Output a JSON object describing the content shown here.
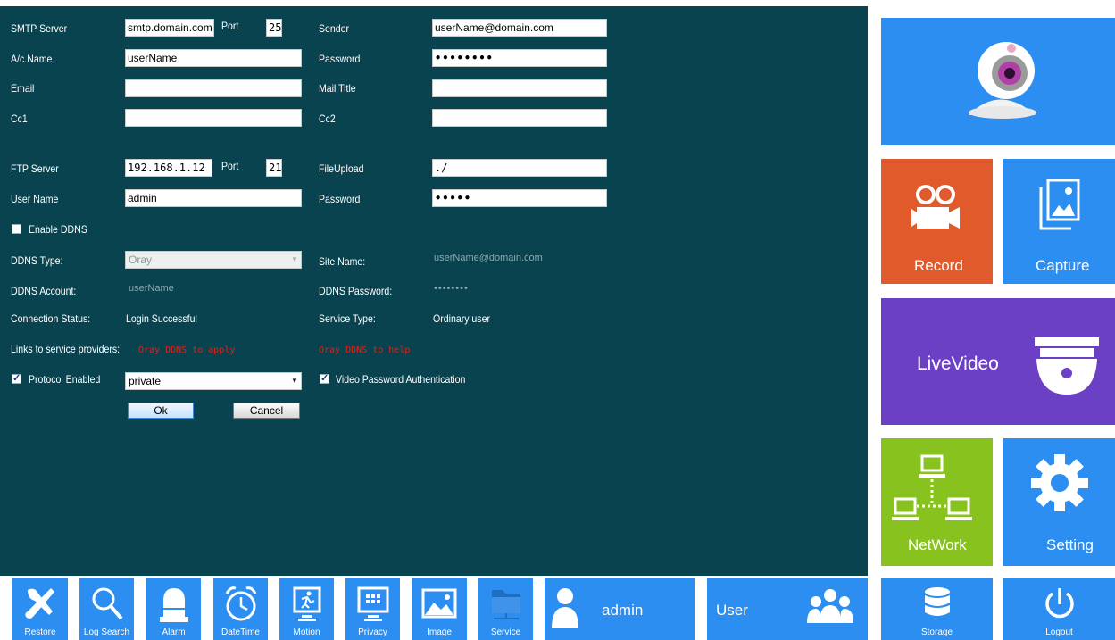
{
  "smtp": {
    "server_label": "SMTP Server",
    "server_value": "smtp.domain.com",
    "port_label": "Port",
    "port_value": "25",
    "sender_label": "Sender",
    "sender_value": "userName@domain.com",
    "account_label": "A/c.Name",
    "account_value": "userName",
    "password_label": "Password",
    "password_value": "••••••••",
    "email_label": "Email",
    "email_value": "",
    "mail_title_label": "Mail Title",
    "mail_title_value": "",
    "cc1_label": "Cc1",
    "cc1_value": "",
    "cc2_label": "Cc2",
    "cc2_value": ""
  },
  "ftp": {
    "server_label": "FTP Server",
    "server_value": "192.168.1.12",
    "port_label": "Port",
    "port_value": "21",
    "upload_label": "FileUpload",
    "upload_value": "./",
    "user_label": "User Name",
    "user_value": "admin",
    "password_label": "Password",
    "password_value": "•••••"
  },
  "ddns": {
    "enable_label": "Enable DDNS",
    "enabled": false,
    "type_label": "DDNS Type:",
    "type_value": "Oray",
    "site_label": "Site Name:",
    "site_value": "userName@domain.com",
    "account_label": "DDNS Account:",
    "account_value": "userName",
    "password_label": "DDNS Password:",
    "password_value": "••••••••",
    "status_label": "Connection Status:",
    "status_value": "Login Successful",
    "service_label": "Service Type:",
    "service_value": "Ordinary user",
    "links_label": "Links to service providers:",
    "apply_link": "Oray DDNS to apply",
    "help_link": "Oray DDNS to help"
  },
  "protocol": {
    "enabled_label": "Protocol Enabled",
    "enabled": true,
    "value": "private",
    "video_auth_label": "Video Password Authentication",
    "video_auth": true
  },
  "buttons": {
    "ok": "Ok",
    "cancel": "Cancel"
  },
  "tiles": {
    "record": "Record",
    "capture": "Capture",
    "livevideo": "LiveVideo",
    "network": "NetWork",
    "setting": "Setting"
  },
  "bottom": {
    "restore": "Restore",
    "log_search": "Log Search",
    "alarm": "Alarm",
    "datetime": "DateTime",
    "motion": "Motion",
    "privacy": "Privacy",
    "image": "Image",
    "service": "Service",
    "user_name": "admin",
    "user_label": "User",
    "storage": "Storage",
    "logout": "Logout"
  },
  "colors": {
    "panel_bg": "#0a4350",
    "tile_blue": "#2b8ef0",
    "tile_orange": "#e05a2b",
    "tile_purple": "#6b40c4",
    "tile_green": "#88c21e",
    "link_red": "#e0201a"
  }
}
